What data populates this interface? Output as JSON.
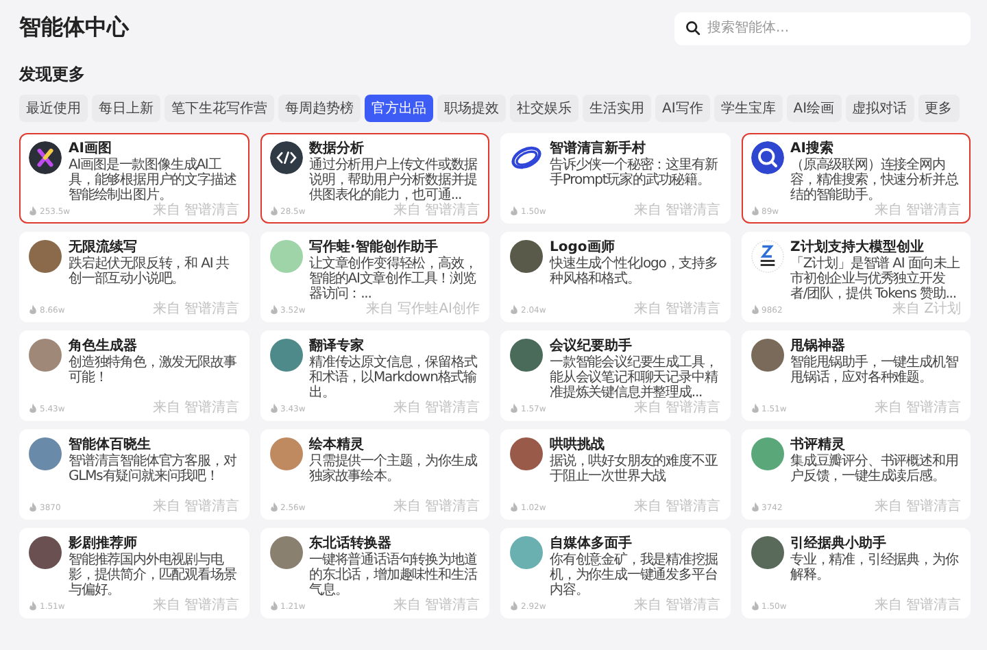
{
  "page_title": "智能体中心",
  "search": {
    "placeholder": "搜索智能体..."
  },
  "section_title": "发现更多",
  "tabs": [
    {
      "label": "最近使用",
      "selected": false
    },
    {
      "label": "每日上新",
      "selected": false
    },
    {
      "label": "笔下生花写作营",
      "selected": false
    },
    {
      "label": "每周趋势榜",
      "selected": false
    },
    {
      "label": "官方出品",
      "selected": true
    },
    {
      "label": "职场提效",
      "selected": false
    },
    {
      "label": "社交娱乐",
      "selected": false
    },
    {
      "label": "生活实用",
      "selected": false
    },
    {
      "label": "AI写作",
      "selected": false
    },
    {
      "label": "学生宝库",
      "selected": false
    },
    {
      "label": "AI绘画",
      "selected": false
    },
    {
      "label": "虚拟对话",
      "selected": false
    },
    {
      "label": "更多",
      "selected": false
    }
  ],
  "cards": [
    {
      "title": "AI画图",
      "description": "AI画图是一款图像生成AI工具，能够根据用户的文字描述智能绘制出图片。",
      "count": "253.5w",
      "source": "来自",
      "author": "智谱清言",
      "kind": "logo-x",
      "highlighted": true
    },
    {
      "title": "数据分析",
      "description": "通过分析用户上传文件或数据说明，帮助用户分析数据并提供图表化的能力，也可通...",
      "count": "28.5w",
      "source": "来自",
      "author": "智谱清言",
      "kind": "code",
      "highlighted": true
    },
    {
      "title": "智谱清言新手村",
      "description": "告诉少侠一个秘密：这里有新手Prompt玩家的武功秘籍。",
      "count": "1.50w",
      "source": "来自",
      "author": "智谱清言",
      "kind": "ring",
      "highlighted": false
    },
    {
      "title": "AI搜索",
      "description": "（原高级联网）连接全网内容，精准搜索，快速分析并总结的智能助手。",
      "count": "89w",
      "source": "来自",
      "author": "智谱清言",
      "kind": "search",
      "highlighted": true
    },
    {
      "title": "无限流续写",
      "description": "跌宕起伏无限反转，和 AI 共创一部互动小说吧。",
      "count": "8.66w",
      "source": "来自",
      "author": "智谱清言",
      "kind": "photo",
      "color": "#8a6a4a",
      "highlighted": false
    },
    {
      "title": "写作蛙·智能创作助手",
      "description": "让文章创作变得轻松，高效，智能的AI文章创作工具！浏览器访问：...",
      "count": "3.52w",
      "source": "来自",
      "author": "写作蛙AI创作",
      "kind": "photo",
      "color": "#9fd3a8",
      "highlighted": false
    },
    {
      "title": "Logo画师",
      "description": "快速生成个性化logo，支持多种风格和格式。",
      "count": "2.04w",
      "source": "来自",
      "author": "智谱清言",
      "kind": "photo",
      "color": "#5a5a4a",
      "highlighted": false
    },
    {
      "title": "Z计划支持大模型创业",
      "description": "「Z计划」是智谱 AI 面向未上市初创企业与优秀独立开发者/团队，提供 Tokens 赞助...",
      "count": "9862",
      "source": "来自",
      "author": "Z计划",
      "kind": "z-plan",
      "highlighted": false
    },
    {
      "title": "角色生成器",
      "description": "创造独特角色，激发无限故事可能！",
      "count": "5.43w",
      "source": "来自",
      "author": "智谱清言",
      "kind": "photo",
      "color": "#a08878",
      "highlighted": false
    },
    {
      "title": "翻译专家",
      "description": "精准传达原文信息，保留格式和术语，以Markdown格式输出。",
      "count": "3.43w",
      "source": "来自",
      "author": "智谱清言",
      "kind": "photo",
      "color": "#4f8a8a",
      "highlighted": false
    },
    {
      "title": "会议纪要助手",
      "description": "一款智能会议纪要生成工具，能从会议笔记和聊天记录中精准提炼关键信息并整理成...",
      "count": "1.57w",
      "source": "来自",
      "author": "智谱清言",
      "kind": "photo",
      "color": "#4a6a5a",
      "highlighted": false
    },
    {
      "title": "甩锅神器",
      "description": "智能甩锅助手，一键生成机智甩锅话，应对各种难题。",
      "count": "1.51w",
      "source": "来自",
      "author": "智谱清言",
      "kind": "photo",
      "color": "#7a6a5a",
      "highlighted": false
    },
    {
      "title": "智能体百晓生",
      "description": "智谱清言智能体官方客服，对GLMs有疑问就来问我吧！",
      "count": "3870",
      "source": "来自",
      "author": "智谱清言",
      "kind": "photo",
      "color": "#6a8aaa",
      "highlighted": false
    },
    {
      "title": "绘本精灵",
      "description": "只需提供一个主题，为你生成独家故事绘本。",
      "count": "2.56w",
      "source": "来自",
      "author": "智谱清言",
      "kind": "photo",
      "color": "#c08a60",
      "highlighted": false
    },
    {
      "title": "哄哄挑战",
      "description": "据说，哄好女朋友的难度不亚于阻止一次世界大战",
      "count": "1.02w",
      "source": "来自",
      "author": "智谱清言",
      "kind": "photo",
      "color": "#9a5a4a",
      "highlighted": false
    },
    {
      "title": "书评精灵",
      "description": "集成豆瓣评分、书评概述和用户反馈，一键生成读后感。",
      "count": "3742",
      "source": "来自",
      "author": "智谱清言",
      "kind": "photo",
      "color": "#5aa87a",
      "highlighted": false
    },
    {
      "title": "影剧推荐师",
      "description": "智能推荐国内外电视剧与电影，提供简介，匹配观看场景与偏好。",
      "count": "1.51w",
      "source": "来自",
      "author": "智谱清言",
      "kind": "photo",
      "color": "#6a5050",
      "highlighted": false
    },
    {
      "title": "东北话转换器",
      "description": "一键将普通话语句转换为地道的东北话，增加趣味性和生活气息。",
      "count": "1.21w",
      "source": "来自",
      "author": "智谱清言",
      "kind": "photo",
      "color": "#8a8070",
      "highlighted": false
    },
    {
      "title": "自媒体多面手",
      "description": "你有创意金矿，我是精准挖掘机，为你生成一键通发多平台内容。",
      "count": "2.92w",
      "source": "来自",
      "author": "智谱清言",
      "kind": "photo",
      "color": "#6ab0b0",
      "highlighted": false
    },
    {
      "title": "引经据典小助手",
      "description": "专业，精准，引经据典，为你解释。",
      "count": "1.50w",
      "source": "来自",
      "author": "智谱清言",
      "kind": "photo",
      "color": "#5a6a5a",
      "highlighted": false
    }
  ]
}
